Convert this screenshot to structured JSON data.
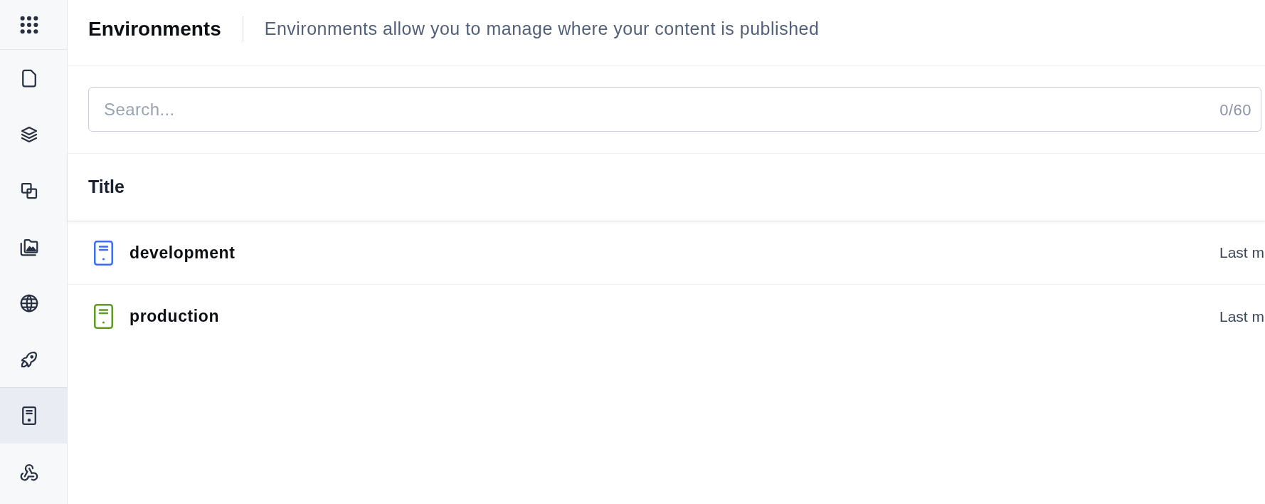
{
  "sidebar": {
    "items": [
      {
        "kind": "document",
        "selected": false
      },
      {
        "kind": "layers",
        "selected": false
      },
      {
        "kind": "squares",
        "selected": false
      },
      {
        "kind": "media",
        "selected": false
      },
      {
        "kind": "globe",
        "selected": false
      },
      {
        "kind": "rocket",
        "selected": false
      },
      {
        "kind": "server",
        "selected": true
      },
      {
        "kind": "webhook",
        "selected": false
      }
    ]
  },
  "header": {
    "title": "Environments",
    "subtitle": "Environments allow you to manage where your content is published"
  },
  "search": {
    "placeholder": "Search...",
    "counter": "0/60"
  },
  "table": {
    "columns": [
      "Title"
    ],
    "rows": [
      {
        "title": "development",
        "color": "#3b6ef0",
        "column_2": "Last m"
      },
      {
        "title": "production",
        "color": "#5f9b23",
        "column_2": "Last m"
      }
    ]
  }
}
